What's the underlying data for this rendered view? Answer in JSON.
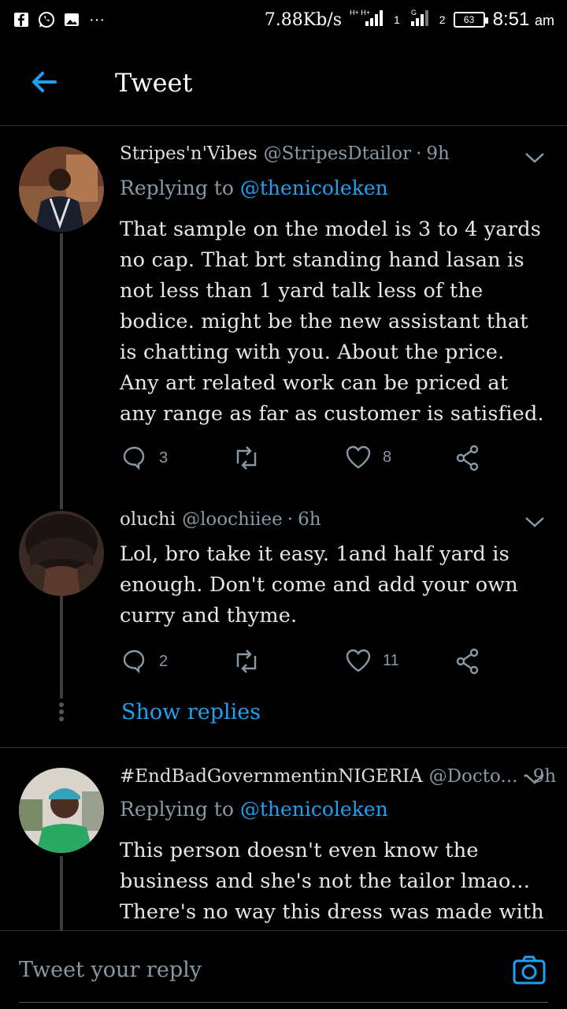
{
  "status_bar": {
    "speed": "7.88Kb/s",
    "battery": "63",
    "time": "8:51",
    "ampm": "am",
    "sim1": "1",
    "sim2": "2"
  },
  "header": {
    "title": "Tweet"
  },
  "tweets": [
    {
      "display_name": "Stripes'n'Vibes",
      "handle": "@StripesDtailor",
      "time": "9h",
      "replying_prefix": "Replying to",
      "replying_to": "@thenicoleken",
      "text": "That sample on the model is 3 to 4 yards no cap. That brt standing hand lasan is not less than 1 yard talk less of the bodice. might be the new assistant that is chatting with you. About the price. Any art related work can be priced at any range as far as customer is satisfied.",
      "replies": "3",
      "retweets": "",
      "likes": "8"
    },
    {
      "display_name": "oluchi",
      "handle": "@loochiiee",
      "time": "6h",
      "text": "Lol, bro take it easy. 1and half yard is enough. Don't come and add your own curry and thyme.",
      "replies": "2",
      "retweets": "",
      "likes": "11"
    },
    {
      "display_name": "#EndBadGovernmentinNIGERIA",
      "handle": "@Docto...",
      "time": "9h",
      "replying_prefix": "Replying to",
      "replying_to": "@thenicoleken",
      "text": "This person doesn't even know the business and she's not the tailor lmao...  There's no way this dress was made with one yard..."
    }
  ],
  "show_replies": "Show replies",
  "reply_bar": {
    "placeholder": "Tweet your reply"
  },
  "colors": {
    "accent": "#1da1f2",
    "muted": "#8899a6",
    "background": "#000000"
  }
}
